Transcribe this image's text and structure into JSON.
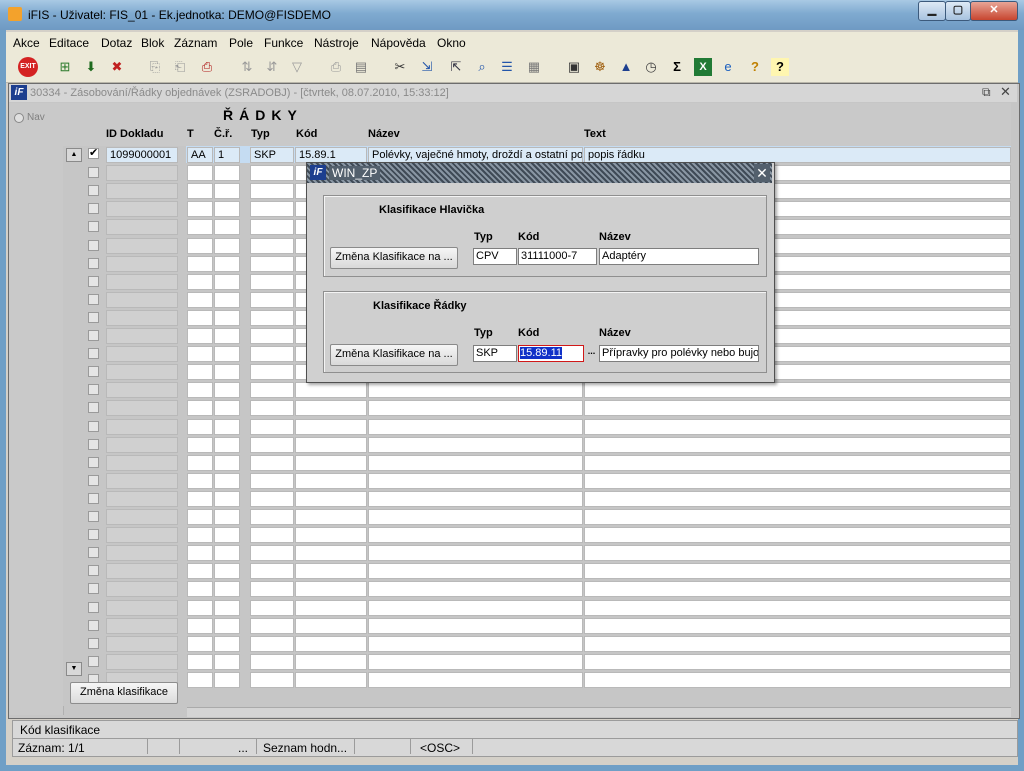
{
  "window": {
    "title": "iFIS - Uživatel: FIS_01 - Ek.jednotka: DEMO@FISDEMO"
  },
  "menu": [
    "Akce",
    "Editace",
    "Dotaz",
    "Blok",
    "Záznam",
    "Pole",
    "Funkce",
    "Nástroje",
    "Nápověda",
    "Okno"
  ],
  "toolbar_icons": [
    "exit-icon",
    "insert-record-icon",
    "save-record-icon",
    "delete-record-icon",
    "copy-icon",
    "paste-icon",
    "print-red-icon",
    "sort-asc-icon",
    "sort-desc-icon",
    "filter-icon",
    "print-icon",
    "preview-icon",
    "cut-icon",
    "export-icon",
    "import-icon",
    "search-icon",
    "list-icon",
    "columns-icon",
    "calculator-icon",
    "settings-icon",
    "mountain-icon",
    "clock-icon",
    "sum-icon",
    "excel-icon",
    "web-icon",
    "help-lookup-icon",
    "help-icon"
  ],
  "form": {
    "title": "30334 - Zásobování/Řádky objednávek (ZSRADOBJ) - [čtvrtek, 08.07.2010, 15:33:12]",
    "nav_label": "Nav",
    "block_title": "ŘÁDKY",
    "columns": {
      "id": "ID Dokladu",
      "t": "T",
      "cr": "Č.ř.",
      "typ": "Typ",
      "kod": "Kód",
      "nazev": "Název",
      "text": "Text"
    },
    "first_row": {
      "id": "1099000001",
      "t": "AA",
      "cr": "1",
      "typ": "SKP",
      "kod": "15.89.1",
      "nazev": "Polévky, vaječné hmoty, droždí a ostatní po",
      "text": "popis řádku"
    },
    "change_button": "Změna klasifikace"
  },
  "dialog": {
    "title": "WIN_ZP",
    "header_group": {
      "title": "Klasifikace Hlavička",
      "labels": {
        "typ": "Typ",
        "kod": "Kód",
        "nazev": "Název"
      },
      "button": "Změna Klasifikace na ...",
      "typ": "CPV",
      "kod": "31111000-7",
      "nazev": "Adaptéry"
    },
    "rows_group": {
      "title": "Klasifikace Řádky",
      "labels": {
        "typ": "Typ",
        "kod": "Kód",
        "nazev": "Název"
      },
      "button": "Změna Klasifikace na ...",
      "typ": "SKP",
      "kod": "15.89.11",
      "nazev": "Přípravky pro polévky nebo bujo",
      "lov": "..."
    }
  },
  "status": {
    "hint": "Kód klasifikace",
    "record": "Záznam: 1/1",
    "ellipsis": "...",
    "list": "Seznam hodn...",
    "osc": "<OSC>"
  }
}
